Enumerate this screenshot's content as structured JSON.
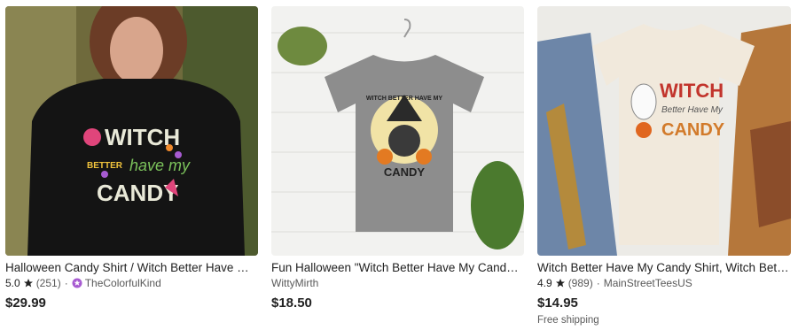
{
  "listings": [
    {
      "title": "Halloween Candy Shirt / Witch Better Have My Candy Sweatshirt",
      "rating": "5.0",
      "reviews": "(251)",
      "shop": "TheColorfulKind",
      "star_icon": "star-icon",
      "shop_icon": "star-seller-badge-icon",
      "price": "$29.99",
      "image_text": [
        "WITCH",
        "BETTER",
        "have my",
        "CANDY"
      ]
    },
    {
      "title": "Fun Halloween \"Witch Better Have My Candy\" Shirt",
      "shop": "WittyMirth",
      "price": "$18.50",
      "image_text": [
        "WITCH BETTER HAVE MY",
        "CANDY"
      ]
    },
    {
      "title": "Witch Better Have My Candy Shirt, Witch Better Have My Candy Tee",
      "rating": "4.9",
      "reviews": "(989)",
      "shop": "MainStreetTeesUS",
      "star_icon": "star-icon",
      "price": "$14.95",
      "shipping": "Free shipping",
      "image_text": [
        "WITCH",
        "Better Have My",
        "CANDY"
      ]
    }
  ],
  "colors": {
    "text": "#222222",
    "muted": "#595959",
    "star_seller_badge": "#a75bd1"
  }
}
